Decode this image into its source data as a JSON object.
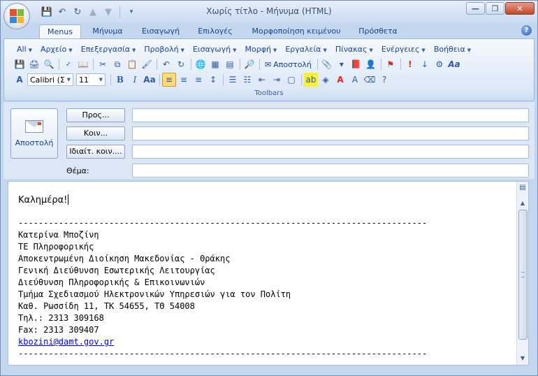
{
  "window": {
    "title": "Χωρίς τίτλο - Μήνυμα (HTML)",
    "minimize": "—",
    "maximize": "❐",
    "close": "✕"
  },
  "ribbon_tabs": [
    "Menus",
    "Μήνυμα",
    "Εισαγωγή",
    "Επιλογές",
    "Μορφοποίηση κειμένου",
    "Πρόσθετα"
  ],
  "menus": [
    "All",
    "Αρχείο",
    "Επεξεργασία",
    "Προβολή",
    "Εισαγωγή",
    "Μορφή",
    "Εργαλεία",
    "Πίνακας",
    "Ενέργειες",
    "Βοήθεια"
  ],
  "toolbar": {
    "send_label": "Αποστολή",
    "font_name": "Calibri (Σ",
    "font_size": "11",
    "bold": "B",
    "italic": "I",
    "font_grow": "Aa",
    "group_label": "Toolbars"
  },
  "header": {
    "send_button": "Αποστολή",
    "to_button": "Προς...",
    "cc_button": "Κοιν...",
    "bcc_button": "Ιδιαίτ. κοιν....",
    "subject_label": "Θέμα:",
    "to_value": "",
    "cc_value": "",
    "bcc_value": "",
    "subject_value": ""
  },
  "body": {
    "greeting": "Καλημέρα!",
    "separator": "---------------------------------------------------------------------------------",
    "signature_lines": [
      "Κατερίνα Μποζίνη",
      "ΤΕ Πληροφορικής",
      "Αποκεντρωμένη Διοίκηση Μακεδονίας - Θράκης",
      "Γενική Διεύθυνση Εσωτερικής Λειτουργίας",
      "Διεύθυνση Πληροφορικής & Επικοινωνιών",
      "Τμήμα Σχεδιασμού Ηλεκτρονικών Υπηρεσιών για τον Πολίτη",
      "Καθ. Ρωσσίδη 11, ΤΚ 54655, ΤΘ 54008",
      "Τηλ.: 2313 309168",
      "Fax: 2313 309407"
    ],
    "email": "kbozini@damt.gov.gr",
    "separator_bottom": "---------------------------------------------------------------------------------"
  }
}
